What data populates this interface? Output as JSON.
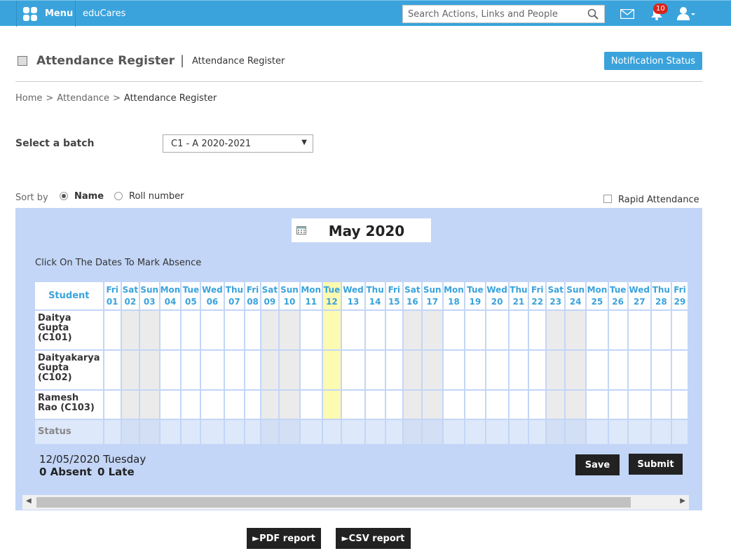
{
  "topbar": {
    "menu_label": "Menu",
    "brand": "eduCares",
    "search_placeholder": "Search Actions, Links and People",
    "notification_count": "10"
  },
  "header": {
    "title": "Attendance Register",
    "separator": "|",
    "subtitle": "Attendance Register",
    "notification_button": "Notification Status"
  },
  "breadcrumb": {
    "home": "Home",
    "attendance": "Attendance",
    "current": "Attendance Register",
    "sep": ">"
  },
  "batch": {
    "label": "Select a batch",
    "selected": "C1 - A 2020-2021"
  },
  "sort": {
    "label": "Sort by",
    "option_name": "Name",
    "option_roll": "Roll number",
    "selected": "name"
  },
  "rapid_attendance_label": "Rapid Attendance",
  "calendar": {
    "month": "May 2020",
    "hint": "Click On The Dates To Mark Absence",
    "student_header": "Student",
    "status_label": "Status",
    "today_index": 11,
    "days": [
      {
        "dow": "Fri",
        "day": "01",
        "weekend": false
      },
      {
        "dow": "Sat",
        "day": "02",
        "weekend": true
      },
      {
        "dow": "Sun",
        "day": "03",
        "weekend": true
      },
      {
        "dow": "Mon",
        "day": "04",
        "weekend": false
      },
      {
        "dow": "Tue",
        "day": "05",
        "weekend": false
      },
      {
        "dow": "Wed",
        "day": "06",
        "weekend": false
      },
      {
        "dow": "Thu",
        "day": "07",
        "weekend": false
      },
      {
        "dow": "Fri",
        "day": "08",
        "weekend": false
      },
      {
        "dow": "Sat",
        "day": "09",
        "weekend": true
      },
      {
        "dow": "Sun",
        "day": "10",
        "weekend": true
      },
      {
        "dow": "Mon",
        "day": "11",
        "weekend": false
      },
      {
        "dow": "Tue",
        "day": "12",
        "weekend": false
      },
      {
        "dow": "Wed",
        "day": "13",
        "weekend": false
      },
      {
        "dow": "Thu",
        "day": "14",
        "weekend": false
      },
      {
        "dow": "Fri",
        "day": "15",
        "weekend": false
      },
      {
        "dow": "Sat",
        "day": "16",
        "weekend": true
      },
      {
        "dow": "Sun",
        "day": "17",
        "weekend": true
      },
      {
        "dow": "Mon",
        "day": "18",
        "weekend": false
      },
      {
        "dow": "Tue",
        "day": "19",
        "weekend": false
      },
      {
        "dow": "Wed",
        "day": "20",
        "weekend": false
      },
      {
        "dow": "Thu",
        "day": "21",
        "weekend": false
      },
      {
        "dow": "Fri",
        "day": "22",
        "weekend": false
      },
      {
        "dow": "Sat",
        "day": "23",
        "weekend": true
      },
      {
        "dow": "Sun",
        "day": "24",
        "weekend": true
      },
      {
        "dow": "Mon",
        "day": "25",
        "weekend": false
      },
      {
        "dow": "Tue",
        "day": "26",
        "weekend": false
      },
      {
        "dow": "Wed",
        "day": "27",
        "weekend": false
      },
      {
        "dow": "Thu",
        "day": "28",
        "weekend": false
      },
      {
        "dow": "Fri",
        "day": "29",
        "weekend": false
      }
    ],
    "students": [
      {
        "name": "Daitya Gupta (C101)"
      },
      {
        "name": "Daityakarya Gupta (C102)"
      },
      {
        "name": "Ramesh Rao (C103)"
      }
    ]
  },
  "summary": {
    "date": "12/05/2020 Tuesday",
    "absent": "0 Absent",
    "late": "0 Late"
  },
  "actions": {
    "save": "Save",
    "submit": "Submit",
    "pdf": "►PDF report",
    "csv": "►CSV report"
  }
}
